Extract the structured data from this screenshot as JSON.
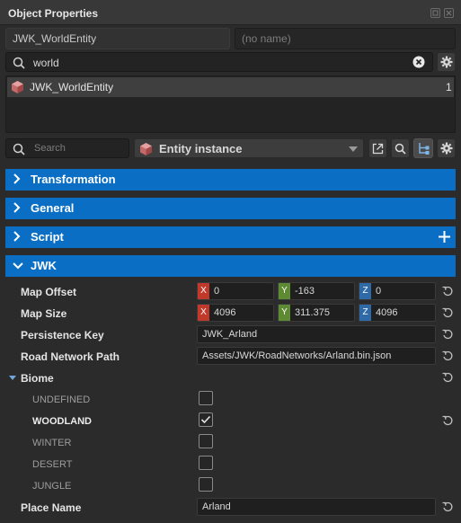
{
  "window": {
    "title": "Object Properties"
  },
  "name_fields": {
    "entity_name": "JWK_WorldEntity",
    "alt_name_placeholder": "(no name)"
  },
  "filter_search": {
    "value": "world"
  },
  "entity_list": [
    {
      "name": "JWK_WorldEntity",
      "count": "1"
    }
  ],
  "inspector": {
    "search_placeholder": "Search",
    "type_dropdown": "Entity instance"
  },
  "sections": [
    {
      "label": "Transformation",
      "expanded": false
    },
    {
      "label": "General",
      "expanded": false
    },
    {
      "label": "Script",
      "expanded": false
    },
    {
      "label": "JWK",
      "expanded": true
    }
  ],
  "properties": {
    "map_offset": {
      "label": "Map Offset",
      "x": "0",
      "y": "-163",
      "z": "0"
    },
    "map_size": {
      "label": "Map Size",
      "x": "4096",
      "y": "311.375",
      "z": "4096"
    },
    "persistence_key": {
      "label": "Persistence Key",
      "value": "JWK_Arland"
    },
    "road_network_path": {
      "label": "Road Network Path",
      "value": "Assets/JWK/RoadNetworks/Arland.bin.json"
    },
    "biome": {
      "label": "Biome",
      "options": [
        {
          "label": "UNDEFINED",
          "checked": false
        },
        {
          "label": "WOODLAND",
          "checked": true
        },
        {
          "label": "WINTER",
          "checked": false
        },
        {
          "label": "DESERT",
          "checked": false
        },
        {
          "label": "JUNGLE",
          "checked": false
        }
      ]
    },
    "place_name": {
      "label": "Place Name",
      "value": "Arland"
    }
  },
  "axis_labels": {
    "x": "X",
    "y": "Y",
    "z": "Z"
  },
  "colors": {
    "section_header": "#0a6fc4",
    "axis_x": "#c0392b",
    "axis_y": "#5d8a32",
    "axis_z": "#2f6aa8"
  }
}
